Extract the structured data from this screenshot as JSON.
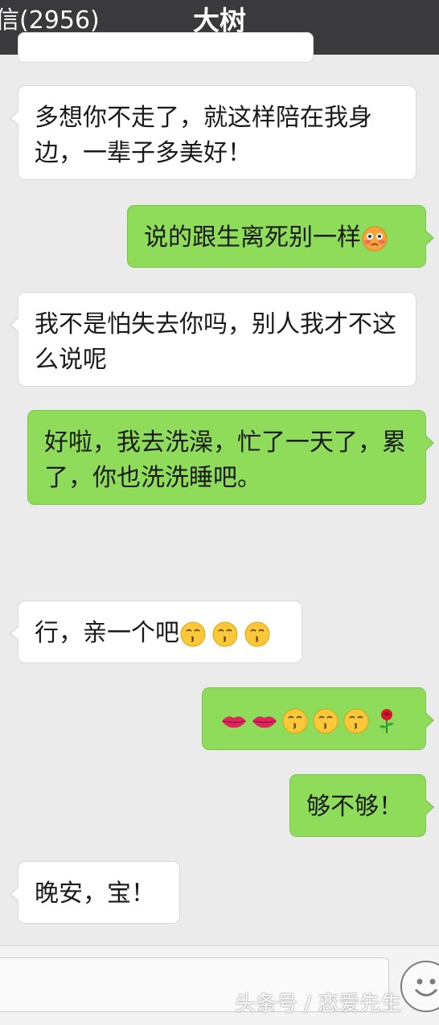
{
  "header": {
    "back_label": "信(2956)",
    "title": "大树"
  },
  "messages": [
    {
      "side": "in",
      "text": "多想你不走了，就这样陪在我身边，一辈子多美好！"
    },
    {
      "side": "out",
      "text": "说的跟生离死别一样",
      "emojis": [
        "flushed-face"
      ]
    },
    {
      "side": "in",
      "text": "我不是怕失去你吗，别人我才不这么说呢"
    },
    {
      "side": "out",
      "text": "好啦，我去洗澡，忙了一天了，累了，你也洗洗睡吧。"
    },
    {
      "side": "in",
      "text": "行，亲一个吧",
      "emojis": [
        "kissing-face",
        "kissing-face",
        "kissing-face"
      ]
    },
    {
      "side": "out",
      "text": "",
      "emojis": [
        "lips",
        "lips",
        "kissing-face",
        "kissing-face",
        "kissing-face",
        "rose"
      ]
    },
    {
      "side": "out",
      "text": "够不够！"
    },
    {
      "side": "in",
      "text": "晚安，宝！"
    }
  ],
  "input": {
    "emoji_button_icon": "smiley-face-icon"
  },
  "watermark": "头条号 / 恋爱先生"
}
